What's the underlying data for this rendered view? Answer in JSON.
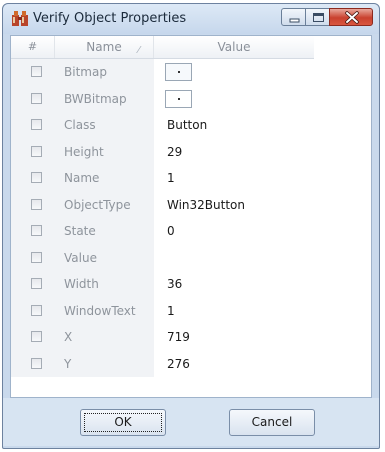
{
  "window": {
    "title": "Verify Object Properties",
    "icon": "app-icon",
    "controls": [
      "minimize-icon",
      "maximize-icon",
      "close-icon"
    ]
  },
  "table": {
    "headers": {
      "check": "#",
      "name": "Name",
      "value": "Value"
    },
    "rows": [
      {
        "name": "Bitmap",
        "value": "",
        "kind": "bitmap"
      },
      {
        "name": "BWBitmap",
        "value": "",
        "kind": "bwbitmap"
      },
      {
        "name": "Class",
        "value": "Button"
      },
      {
        "name": "Height",
        "value": "29"
      },
      {
        "name": "Name",
        "value": "1"
      },
      {
        "name": "ObjectType",
        "value": "Win32Button"
      },
      {
        "name": "State",
        "value": "0"
      },
      {
        "name": "Value",
        "value": ""
      },
      {
        "name": "Width",
        "value": "36"
      },
      {
        "name": "WindowText",
        "value": "1"
      },
      {
        "name": "X",
        "value": "719"
      },
      {
        "name": "Y",
        "value": "276"
      }
    ]
  },
  "buttons": {
    "ok": "OK",
    "cancel": "Cancel"
  }
}
